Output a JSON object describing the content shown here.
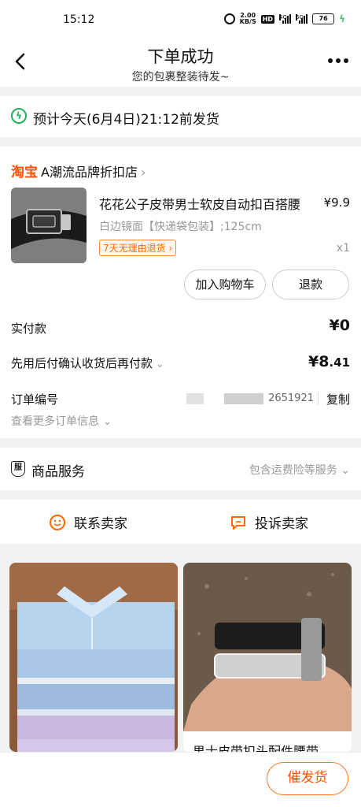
{
  "status_bar": {
    "time": "15:12",
    "net_speed_value": "2.00",
    "net_speed_unit": "KB/S",
    "hd_label": "HD",
    "signal1_tag": "4G",
    "signal2_tag": "5G",
    "battery": "76"
  },
  "header": {
    "title": "下单成功",
    "subtitle": "您的包裹整装待发~"
  },
  "shipping": {
    "text": "预计今天(6月4日)21:12前发货"
  },
  "order": {
    "shop_brand": "淘宝",
    "shop_name": "A潮流品牌折扣店",
    "product_title": "花花公子皮带男士软皮自动扣百搭腰",
    "product_price": "¥9.9",
    "product_sku": "白边镜面【快递袋包装】;125cm",
    "return_policy": "7天无理由退货",
    "quantity": "x1",
    "add_to_cart": "加入购物车",
    "refund": "退款",
    "paid_label": "实付款",
    "paid_value": "¥0",
    "pay_later_label": "先用后付确认收货后再付款",
    "pay_later_currency": "¥",
    "pay_later_int": "8",
    "pay_later_dec": ".41",
    "order_no_label": "订单编号",
    "order_no_visible": "2651921",
    "copy": "复制",
    "more_info": "查看更多订单信息"
  },
  "service": {
    "label": "商品服务",
    "value": "包含运费险等服务"
  },
  "contact": {
    "seller": "联系卖家",
    "complain": "投诉卖家"
  },
  "recommendations": [
    {
      "caption": ""
    },
    {
      "caption": "男士皮带扣头配件腰带"
    }
  ],
  "bottom": {
    "urge_ship": "催发货"
  },
  "colors": {
    "accent": "#ff5000",
    "success": "#21b25a",
    "background": "#f2f2f2"
  }
}
